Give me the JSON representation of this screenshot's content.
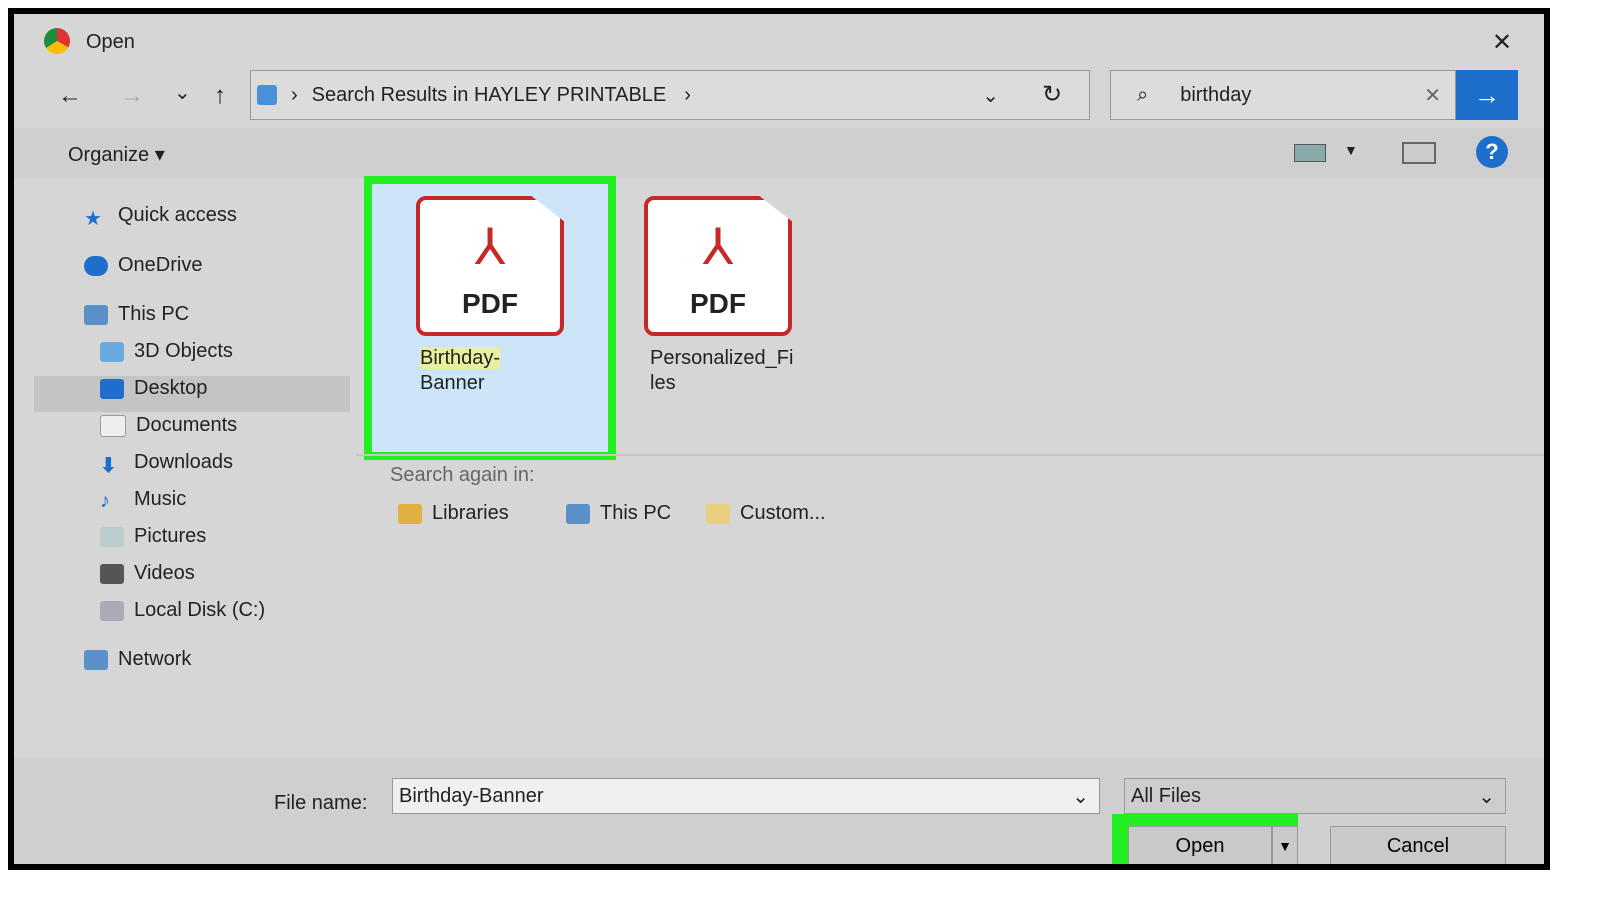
{
  "window": {
    "title": "Open",
    "close": "✕"
  },
  "toolbar": {
    "back": "←",
    "forward": "→",
    "recent": "⌄",
    "up": "↑",
    "breadcrumb": "Search Results in HAYLEY PRINTABLE",
    "sep": "›",
    "refresh": "↻",
    "search_value": "birthday",
    "search_go": "→",
    "organize": "Organize ▾",
    "help": "?"
  },
  "sidebar": {
    "items": [
      {
        "label": "Quick access",
        "icon": "star-icon"
      },
      {
        "label": "OneDrive",
        "icon": "cloud-icon"
      },
      {
        "label": "This PC",
        "icon": "computer-icon"
      },
      {
        "label": "3D Objects",
        "icon": "cube-icon"
      },
      {
        "label": "Desktop",
        "icon": "desktop-icon"
      },
      {
        "label": "Documents",
        "icon": "document-icon"
      },
      {
        "label": "Downloads",
        "icon": "download-icon"
      },
      {
        "label": "Music",
        "icon": "music-icon"
      },
      {
        "label": "Pictures",
        "icon": "pictures-icon"
      },
      {
        "label": "Videos",
        "icon": "video-icon"
      },
      {
        "label": "Local Disk (C:)",
        "icon": "disk-icon"
      },
      {
        "label": "Network",
        "icon": "network-icon"
      }
    ]
  },
  "files": [
    {
      "name1": "Birthday-",
      "name2": "Banner",
      "type": "PDF"
    },
    {
      "name1": "Personalized_Fi",
      "name2": "les",
      "type": "PDF"
    }
  ],
  "search_again": {
    "label": "Search again in:",
    "options": [
      "Libraries",
      "This PC",
      "Custom..."
    ]
  },
  "footer": {
    "file_name_label": "File name:",
    "file_name_value": "Birthday-Banner",
    "file_type": "All Files",
    "open": "Open",
    "cancel": "Cancel"
  },
  "colors": {
    "highlight": "#22ee22",
    "accent": "#1e6fcc",
    "pdf": "#c62828"
  }
}
